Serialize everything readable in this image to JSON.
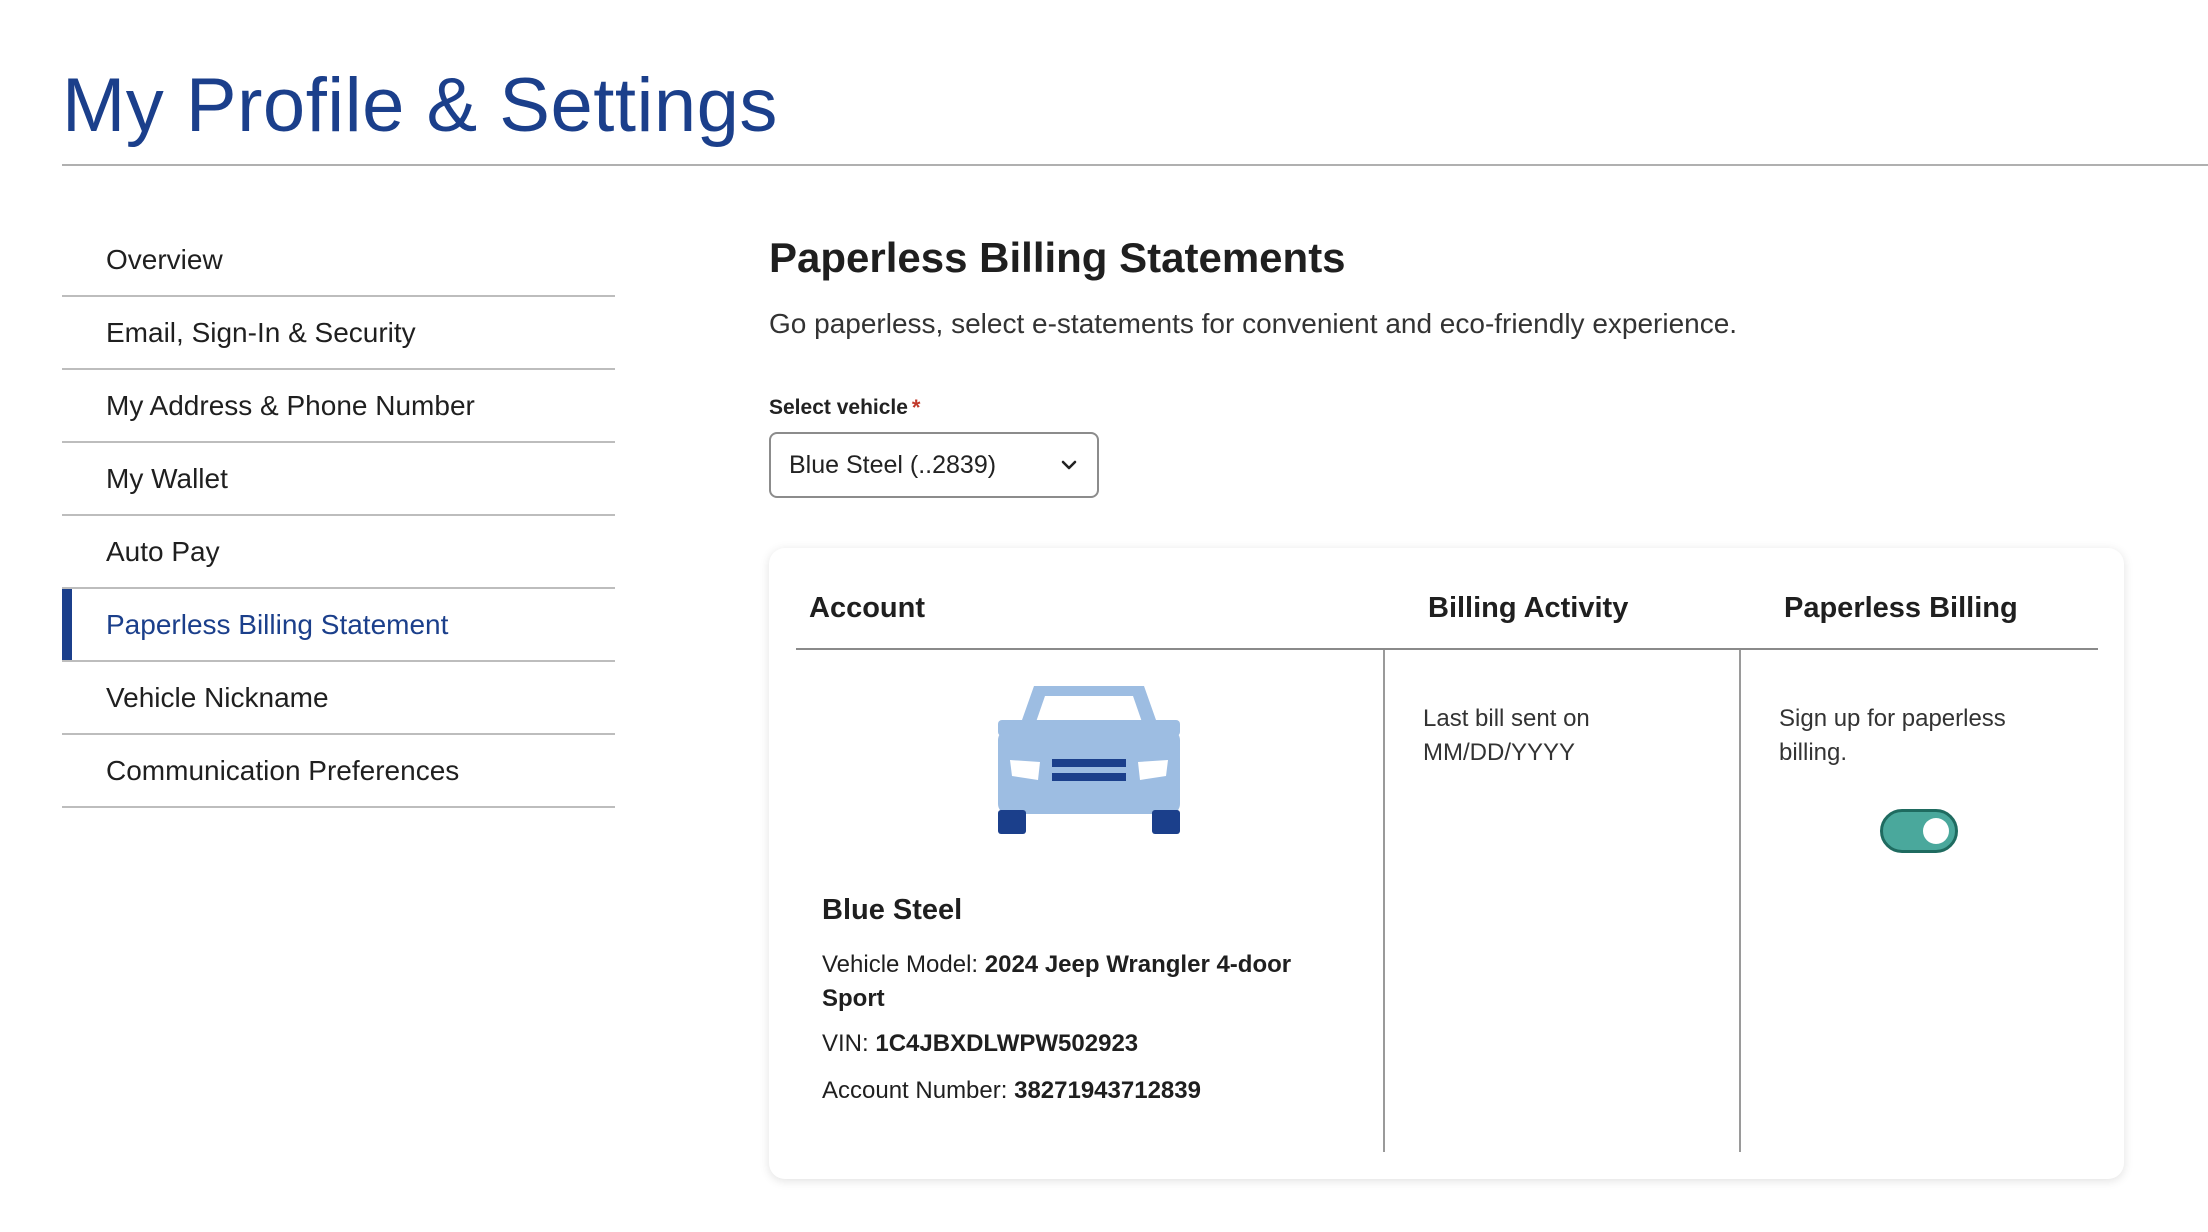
{
  "page": {
    "title": "My Profile & Settings"
  },
  "sidebar": {
    "items": [
      {
        "label": "Overview"
      },
      {
        "label": "Email, Sign-In & Security"
      },
      {
        "label": "My Address & Phone Number"
      },
      {
        "label": "My Wallet"
      },
      {
        "label": "Auto Pay"
      },
      {
        "label": "Paperless Billing Statement",
        "active": true
      },
      {
        "label": "Vehicle Nickname"
      },
      {
        "label": "Communication Preferences"
      }
    ]
  },
  "main": {
    "title": "Paperless Billing Statements",
    "description": "Go paperless, select e-statements for convenient and eco-friendly experience.",
    "select": {
      "label": "Select vehicle",
      "required_mark": "*",
      "value": "Blue Steel (..2839)"
    }
  },
  "card": {
    "headers": {
      "account": "Account",
      "activity": "Billing Activity",
      "paperless": "Paperless Billing"
    },
    "vehicle": {
      "name": "Blue Steel",
      "model_label": "Vehicle Model:",
      "model_value": "2024 Jeep Wrangler 4-door Sport",
      "vin_label": "VIN:",
      "vin_value": "1C4JBXDLWPW502923",
      "account_label": "Account Number:",
      "account_value": "38271943712839"
    },
    "activity_text": "Last bill sent on MM/DD/YYYY",
    "paperless_text": "Sign up for paperless billing.",
    "paperless_enabled": true
  },
  "colors": {
    "brand": "#1b3f8b",
    "toggle_on": "#4aa89c",
    "car_body": "#9dbde2",
    "car_dark": "#1b3f8b"
  }
}
